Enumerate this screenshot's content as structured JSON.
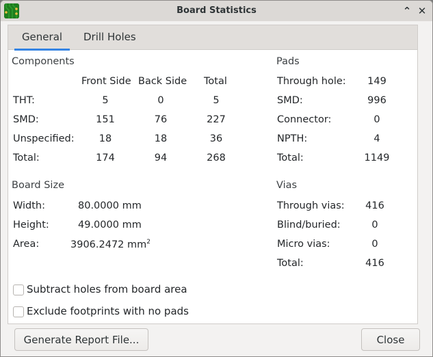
{
  "window": {
    "title": "Board Statistics",
    "app_icon": "pcb-board-icon",
    "minimize_glyph": "⌃",
    "close_glyph": "✕"
  },
  "tabs": [
    {
      "label": "General",
      "active": true
    },
    {
      "label": "Drill Holes",
      "active": false
    }
  ],
  "components": {
    "title": "Components",
    "columns": [
      "Front Side",
      "Back Side",
      "Total"
    ],
    "rows": [
      {
        "label": "THT:",
        "values": [
          "5",
          "0",
          "5"
        ]
      },
      {
        "label": "SMD:",
        "values": [
          "151",
          "76",
          "227"
        ]
      },
      {
        "label": "Unspecified:",
        "values": [
          "18",
          "18",
          "36"
        ]
      },
      {
        "label": "Total:",
        "values": [
          "174",
          "94",
          "268"
        ]
      }
    ]
  },
  "pads": {
    "title": "Pads",
    "rows": [
      {
        "label": "Through hole:",
        "value": "149"
      },
      {
        "label": "SMD:",
        "value": "996"
      },
      {
        "label": "Connector:",
        "value": "0"
      },
      {
        "label": "NPTH:",
        "value": "4"
      },
      {
        "label": "Total:",
        "value": "1149"
      }
    ]
  },
  "board_size": {
    "title": "Board Size",
    "rows": [
      {
        "label": "Width:",
        "value": "80.0000 mm"
      },
      {
        "label": "Height:",
        "value": "49.0000 mm"
      },
      {
        "label": "Area:",
        "value": "3906.2472 mm",
        "superscript": "2"
      }
    ]
  },
  "vias": {
    "title": "Vias",
    "rows": [
      {
        "label": "Through vias:",
        "value": "416"
      },
      {
        "label": "Blind/buried:",
        "value": "0"
      },
      {
        "label": "Micro vias:",
        "value": "0"
      },
      {
        "label": "Total:",
        "value": "416"
      }
    ]
  },
  "options": [
    {
      "label": "Subtract holes from board area",
      "checked": false
    },
    {
      "label": "Exclude footprints with no pads",
      "checked": false
    }
  ],
  "buttons": {
    "generate_report": "Generate Report File...",
    "close": "Close"
  },
  "colors": {
    "accent": "#3584e4",
    "titlebar": "#dcd9d6",
    "tabbar": "#e1dedb",
    "window_bg": "#f3f2f1"
  }
}
